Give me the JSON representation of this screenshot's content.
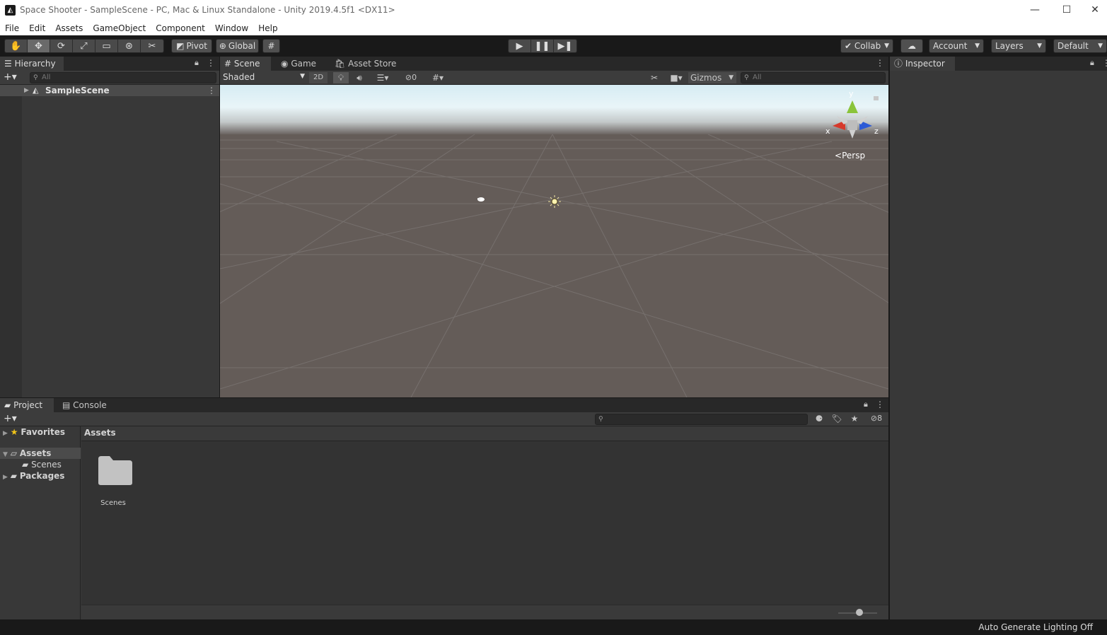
{
  "window": {
    "title": "Space Shooter - SampleScene - PC, Mac & Linux Standalone - Unity 2019.4.5f1 <DX11>",
    "minimize": "—",
    "maximize": "☐",
    "close": "✕"
  },
  "menu": [
    "File",
    "Edit",
    "Assets",
    "GameObject",
    "Component",
    "Window",
    "Help"
  ],
  "toolbar": {
    "pivot_label": "Pivot",
    "global_label": "Global",
    "collab_label": "Collab",
    "account_label": "Account",
    "layers_label": "Layers",
    "layout_label": "Default"
  },
  "hierarchy": {
    "tab_label": "Hierarchy",
    "search_placeholder": "All",
    "scene_name": "SampleScene"
  },
  "scene": {
    "tabs": [
      "Scene",
      "Game",
      "Asset Store"
    ],
    "shading_mode": "Shaded",
    "mode_2d": "2D",
    "hidden_count": "0",
    "gizmos_label": "Gizmos",
    "search_placeholder": "All",
    "gizmo_axes": {
      "x": "x",
      "y": "y",
      "z": "z"
    },
    "persp_label": "Persp"
  },
  "inspector": {
    "tab_label": "Inspector"
  },
  "project": {
    "tabs": [
      "Project",
      "Console"
    ],
    "hidden_count": "8",
    "breadcrumb": "Assets",
    "tree": {
      "favorites": "Favorites",
      "assets": "Assets",
      "scenes": "Scenes",
      "packages": "Packages"
    },
    "items": [
      {
        "name": "Scenes"
      }
    ],
    "thumbnail_size": 0.55
  },
  "status": {
    "text": "Auto Generate Lighting Off"
  },
  "colors": {
    "accent_gizmo_x": "#d63a2c",
    "accent_gizmo_y": "#8ac43a",
    "accent_gizmo_z": "#2d5bd6",
    "panel": "#383838",
    "toolbar": "#191919"
  }
}
